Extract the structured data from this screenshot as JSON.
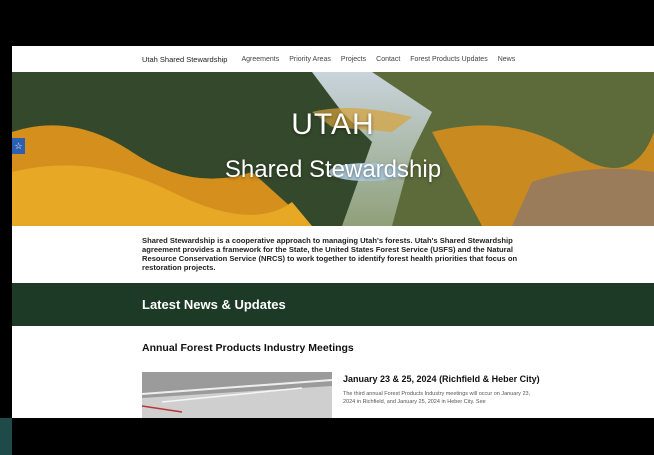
{
  "nav": {
    "brand": "Utah Shared Stewardship",
    "items": [
      "Agreements",
      "Priority Areas",
      "Projects",
      "Contact",
      "Forest Products Updates",
      "News"
    ]
  },
  "hero": {
    "title": "UTAH",
    "subtitle": "Shared Stewardship",
    "accessibility_icon": "accessibility-icon"
  },
  "intro": {
    "text": "Shared Stewardship is a cooperative approach to managing Utah's forests. Utah's Shared Stewardship agreement provides a framework for the State, the United States Forest Service (USFS) and the Natural Resource Conservation Service (NRCS) to work together to identify forest health priorities that focus on restoration projects."
  },
  "news": {
    "heading": "Latest News & Updates",
    "section_title": "Annual Forest Products Industry Meetings",
    "article": {
      "title": "January 23 & 25, 2024 (Richfield & Heber City)",
      "excerpt": "The third annual Forest Products Industry meetings will occur on January 23, 2024 in Richfield, and January 25, 2024 in Heber City. See"
    }
  },
  "colors": {
    "news_band": "#1c3a26",
    "accessibility_button": "#2d5fb3"
  }
}
